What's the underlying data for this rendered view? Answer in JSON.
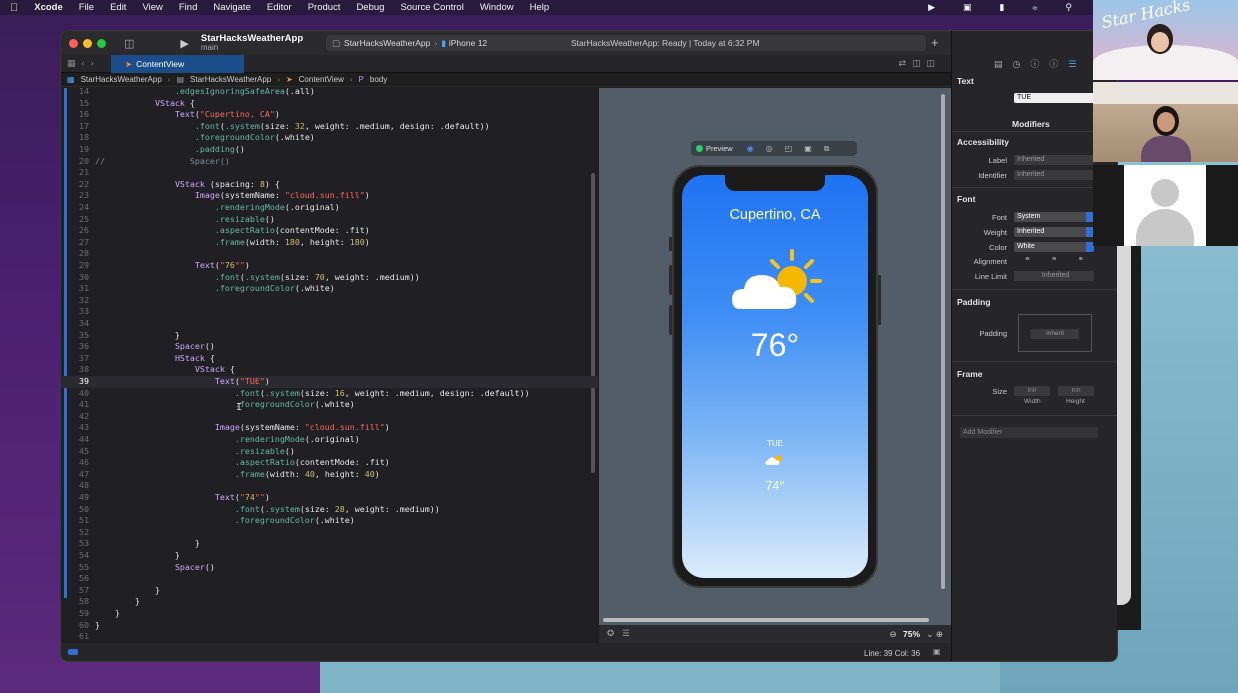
{
  "menubar": {
    "app": "Xcode",
    "items": [
      "File",
      "Edit",
      "View",
      "Find",
      "Navigate",
      "Editor",
      "Product",
      "Debug",
      "Source Control",
      "Window",
      "Help"
    ]
  },
  "toolbar": {
    "scheme_title": "StarHacksWeatherApp",
    "scheme_subtitle": "main",
    "destination_app": "StarHacksWeatherApp",
    "destination_device": "iPhone 12",
    "status": "StarHacksWeatherApp: Ready | Today at 6:32 PM"
  },
  "tab": {
    "label": "ContentView"
  },
  "breadcrumb": [
    "StarHacksWeatherApp",
    "StarHacksWeatherApp",
    "ContentView",
    "body"
  ],
  "code_lines": [
    {
      "n": "14",
      "t": "                .edgesIgnoringSafeArea(.all)"
    },
    {
      "n": "15",
      "t": "            VStack {"
    },
    {
      "n": "16",
      "t": "                Text(\"Cupertino, CA\")"
    },
    {
      "n": "17",
      "t": "                    .font(.system(size: 32, weight: .medium, design: .default))"
    },
    {
      "n": "18",
      "t": "                    .foregroundColor(.white)"
    },
    {
      "n": "19",
      "t": "                    .padding()"
    },
    {
      "n": "20",
      "t": "//                 Spacer()"
    },
    {
      "n": "21",
      "t": ""
    },
    {
      "n": "22",
      "t": "                VStack (spacing: 8) {"
    },
    {
      "n": "23",
      "t": "                    Image(systemName: \"cloud.sun.fill\")"
    },
    {
      "n": "24",
      "t": "                        .renderingMode(.original)"
    },
    {
      "n": "25",
      "t": "                        .resizable()"
    },
    {
      "n": "26",
      "t": "                        .aspectRatio(contentMode: .fit)"
    },
    {
      "n": "27",
      "t": "                        .frame(width: 180, height: 180)"
    },
    {
      "n": "28",
      "t": ""
    },
    {
      "n": "29",
      "t": "                    Text(\"76°\")"
    },
    {
      "n": "30",
      "t": "                        .font(.system(size: 70, weight: .medium))"
    },
    {
      "n": "31",
      "t": "                        .foregroundColor(.white)"
    },
    {
      "n": "32",
      "t": ""
    },
    {
      "n": "33",
      "t": ""
    },
    {
      "n": "34",
      "t": ""
    },
    {
      "n": "35",
      "t": "                }"
    },
    {
      "n": "36",
      "t": "                Spacer()"
    },
    {
      "n": "37",
      "t": "                HStack {"
    },
    {
      "n": "38",
      "t": "                    VStack {"
    },
    {
      "n": "39",
      "t": "                        Text(\"TUE\")"
    },
    {
      "n": "40",
      "t": "                            .font(.system(size: 16, weight: .medium, design: .default))"
    },
    {
      "n": "41",
      "t": "                            .foregroundColor(.white)"
    },
    {
      "n": "42",
      "t": ""
    },
    {
      "n": "43",
      "t": "                        Image(systemName: \"cloud.sun.fill\")"
    },
    {
      "n": "44",
      "t": "                            .renderingMode(.original)"
    },
    {
      "n": "45",
      "t": "                            .resizable()"
    },
    {
      "n": "46",
      "t": "                            .aspectRatio(contentMode: .fit)"
    },
    {
      "n": "47",
      "t": "                            .frame(width: 40, height: 40)"
    },
    {
      "n": "48",
      "t": ""
    },
    {
      "n": "49",
      "t": "                        Text(\"74°\")"
    },
    {
      "n": "50",
      "t": "                            .font(.system(size: 28, weight: .medium))"
    },
    {
      "n": "51",
      "t": "                            .foregroundColor(.white)"
    },
    {
      "n": "52",
      "t": ""
    },
    {
      "n": "53",
      "t": "                    }"
    },
    {
      "n": "54",
      "t": "                }"
    },
    {
      "n": "55",
      "t": "                Spacer()"
    },
    {
      "n": "56",
      "t": ""
    },
    {
      "n": "57",
      "t": "            }"
    },
    {
      "n": "58",
      "t": "        }"
    },
    {
      "n": "59",
      "t": "    }"
    },
    {
      "n": "60",
      "t": "}"
    },
    {
      "n": "61",
      "t": ""
    }
  ],
  "current_line": "39",
  "preview": {
    "label": "Preview",
    "city": "Cupertino, CA",
    "temp": "76°",
    "day": "TUE",
    "day_temp": "74°",
    "zoom": "75%"
  },
  "statusbar": {
    "line_col": "Line: 39  Col: 36"
  },
  "inspector": {
    "title": "Text",
    "text_value": "TUE",
    "modifiers_header": "Modifiers",
    "accessibility": "Accessibility",
    "label": "Label",
    "label_placeholder": "Inherited",
    "identifier": "Identifier",
    "identifier_placeholder": "Inherited",
    "font_header": "Font",
    "font": "Font",
    "font_value": "System",
    "weight": "Weight",
    "weight_value": "Inherited",
    "color": "Color",
    "color_value": "White",
    "alignment": "Alignment",
    "line_limit": "Line Limit",
    "line_limit_value": "Inherited",
    "padding_header": "Padding",
    "padding": "Padding",
    "padding_value": "Inherit",
    "frame_header": "Frame",
    "size": "Size",
    "width_value": "Inh",
    "height_value": "Inh",
    "width": "Width",
    "height": "Height",
    "add_modifier": "Add Modifier"
  },
  "video": {
    "logo": "Star Hacks"
  },
  "colors": {
    "accent": "#2f6fd6",
    "preview_top": "#1f72f2",
    "preview_bottom": "#dcecfb"
  }
}
